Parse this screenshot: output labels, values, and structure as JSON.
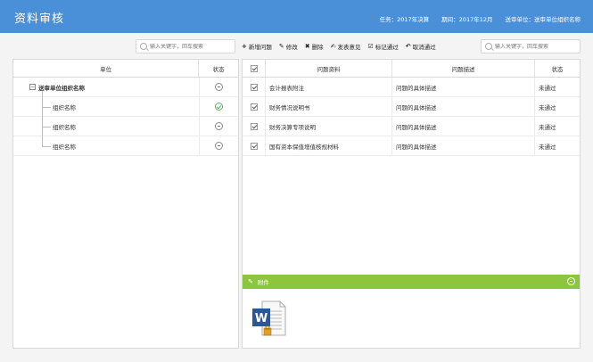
{
  "header": {
    "title": "资料审核",
    "task": "任务：2017年决算",
    "period": "期间：2017年12月",
    "unit": "送审单位：送审单位组织名称"
  },
  "left": {
    "search_placeholder": "输入关键字，回车搜索",
    "columns": {
      "unit": "单位",
      "status": "状态"
    },
    "root": {
      "label": "送审单位组织名称",
      "status_icon": "minus-circle-icon"
    },
    "children": [
      {
        "label": "组织名称",
        "status_icon": "check-circle-icon"
      },
      {
        "label": "组织名称",
        "status_icon": "minus-circle-icon"
      },
      {
        "label": "组织名称",
        "status_icon": "minus-circle-icon"
      }
    ]
  },
  "toolbar": {
    "add": "新增问题",
    "edit": "修改",
    "delete": "删除",
    "publish": "发表意见",
    "mark": "标记通过",
    "cancel": "取消通过",
    "search_placeholder": "输入关键字，回车搜索"
  },
  "grid": {
    "columns": {
      "doc": "问题资料",
      "desc": "问题描述",
      "status": "状态"
    },
    "rows": [
      {
        "doc": "会计报表附注",
        "desc": "问题的具体描述",
        "status": "未通过",
        "checked": true
      },
      {
        "doc": "财务情况说明书",
        "desc": "问题的具体描述",
        "status": "未通过",
        "checked": true
      },
      {
        "doc": "财务决算专项说明",
        "desc": "问题的具体描述",
        "status": "未通过",
        "checked": true
      },
      {
        "doc": "国有资本保值增值核规材料",
        "desc": "问题的具体描述",
        "status": "未通过",
        "checked": true
      }
    ]
  },
  "attachment": {
    "label": "附件",
    "file_icon": "word-document-icon"
  },
  "colors": {
    "header": "#4a90d9",
    "attach_bar": "#8cc63f",
    "check": "#5cb85c"
  }
}
